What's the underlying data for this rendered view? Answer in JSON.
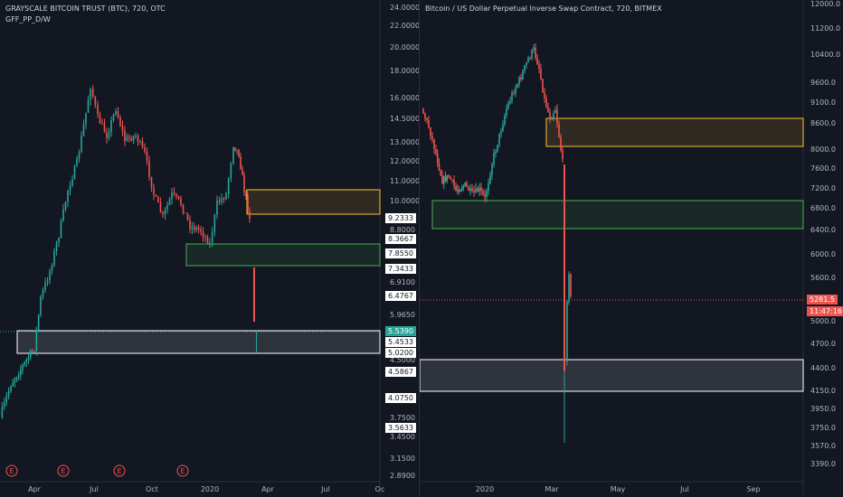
{
  "left_chart": {
    "title": "GRAYSCALE BITCOIN TRUST (BTC), 720, OTC",
    "indicator": "GFF_PP_D/W",
    "axis_labels": [
      "24.0000",
      "22.0000",
      "20.0000",
      "18.0000",
      "16.0000",
      "14.5000",
      "13.0000",
      "12.0000",
      "11.0000",
      "10.0000",
      "8.8000",
      "6.9100",
      "5.9650",
      "4.5000",
      "3.7500",
      "3.4500",
      "3.1500",
      "2.8900"
    ],
    "price_tags": [
      "9.2333",
      "8.3667",
      "7.8550",
      "7.3433",
      "6.4767",
      "5.4533",
      "5.0200",
      "4.5867",
      "4.0750",
      "3.5633"
    ],
    "current_price": "5.5390",
    "x_labels": [
      "Apr",
      "Jul",
      "Oct",
      "2020",
      "Apr",
      "Jul",
      "Oc"
    ],
    "earnings_marker": "E",
    "zones": [
      {
        "name": "supply",
        "low": 8.9,
        "high": 10.4,
        "color": "#fbc02d"
      },
      {
        "name": "support",
        "low": 7.5,
        "high": 8.4,
        "color": "#4caf50"
      },
      {
        "name": "base",
        "low": 5.0,
        "high": 5.6,
        "color": "#ffffff"
      }
    ],
    "colors": {
      "up": "#26a69a",
      "down": "#ef5350"
    }
  },
  "right_chart": {
    "title": "Bitcoin / US Dollar Perpetual Inverse Swap Contract, 720, BITMEX",
    "axis_labels": [
      "12000.0",
      "11200.0",
      "10400.0",
      "9600.0",
      "9100.0",
      "8600.0",
      "8000.0",
      "7600.0",
      "7200.0",
      "6800.0",
      "6400.0",
      "6000.0",
      "5600.0",
      "5000.0",
      "4700.0",
      "4400.0",
      "4150.0",
      "3950.0",
      "3750.0",
      "3570.0",
      "3390.0"
    ],
    "last_price": "5281.5",
    "countdown": "11:47:16",
    "x_labels": [
      "2020",
      "Mar",
      "May",
      "Jul",
      "Sep"
    ],
    "zones": [
      {
        "name": "supply",
        "low": 8100,
        "high": 8700,
        "color": "#fbc02d"
      },
      {
        "name": "support",
        "low": 6450,
        "high": 6950,
        "color": "#4caf50"
      },
      {
        "name": "base",
        "low": 4120,
        "high": 4500,
        "color": "#ffffff"
      }
    ],
    "colors": {
      "up": "#26a69a",
      "down": "#ef5350",
      "last": "#ef5350"
    }
  }
}
